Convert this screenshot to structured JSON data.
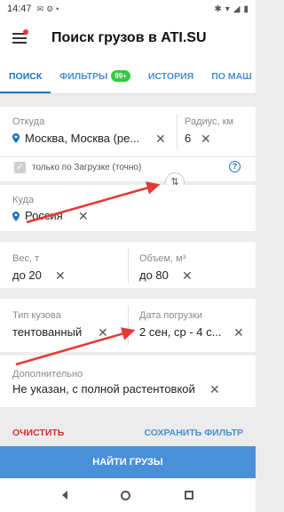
{
  "status": {
    "time": "14:47"
  },
  "app": {
    "title": "Поиск грузов в ATI.SU"
  },
  "tabs": [
    {
      "label": "ПОИСК"
    },
    {
      "label": "ФИЛЬТРЫ",
      "badge": "99+"
    },
    {
      "label": "ИСТОРИЯ"
    },
    {
      "label": "ПО МАШ"
    }
  ],
  "from": {
    "label": "Откуда",
    "value": "Москва, Москва (ре...",
    "radius_label": "Радиус, км",
    "radius_value": "6"
  },
  "only_load": {
    "label": "только по Загрузке (точно)",
    "checked": true
  },
  "to": {
    "label": "Куда",
    "value": "Россия"
  },
  "weight": {
    "label": "Вес, т",
    "value": "до 20"
  },
  "volume": {
    "label": "Объем, м³",
    "value": "до 80"
  },
  "body_type": {
    "label": "Тип кузова",
    "value": "тентованный"
  },
  "load_date": {
    "label": "Дата погрузки",
    "value": "2 сен, ср - 4 с..."
  },
  "extra": {
    "label": "Дополнительно",
    "value": "Не указан, с полной растентовкой"
  },
  "actions": {
    "clear": "ОЧИСТИТЬ",
    "save": "СОХРАНИТЬ ФИЛЬТР",
    "find": "НАЙТИ ГРУЗЫ"
  },
  "colors": {
    "accent": "#1e73be",
    "button": "#4a90d9",
    "danger": "#d32f2f",
    "annotation_arrow": "#e53935"
  }
}
